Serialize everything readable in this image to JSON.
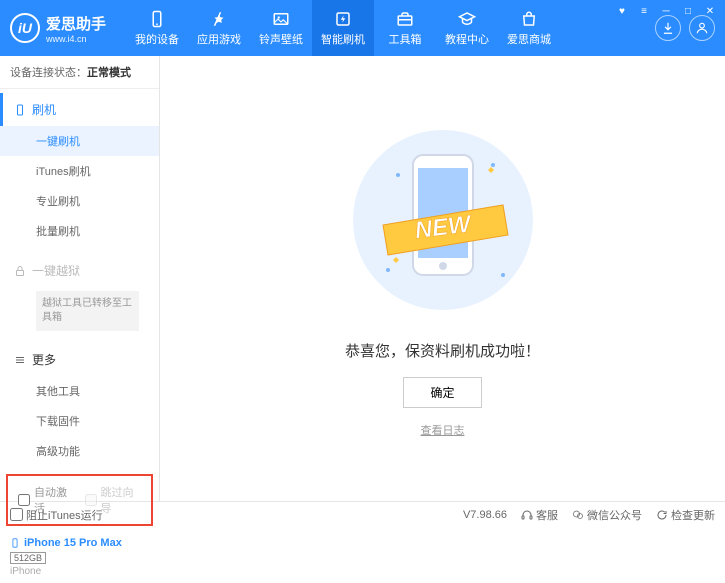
{
  "app": {
    "title": "爱思助手",
    "subtitle": "www.i4.cn",
    "logoLetter": "iU"
  },
  "nav": {
    "items": [
      {
        "label": "我的设备"
      },
      {
        "label": "应用游戏"
      },
      {
        "label": "铃声壁纸"
      },
      {
        "label": "智能刷机"
      },
      {
        "label": "工具箱"
      },
      {
        "label": "教程中心"
      },
      {
        "label": "爱思商城"
      }
    ],
    "activeIndex": 3
  },
  "status": {
    "prefix": "设备连接状态：",
    "mode": "正常模式"
  },
  "sidebar": {
    "flash": {
      "header": "刷机",
      "items": [
        "一键刷机",
        "iTunes刷机",
        "专业刷机",
        "批量刷机"
      ],
      "activeIndex": 0
    },
    "jailbreak": {
      "header": "一键越狱",
      "notice": "越狱工具已转移至工具箱"
    },
    "more": {
      "header": "更多",
      "items": [
        "其他工具",
        "下载固件",
        "高级功能"
      ]
    }
  },
  "checkboxes": {
    "autoActivate": "自动激活",
    "skipGuide": "跳过向导"
  },
  "device": {
    "name": "iPhone 15 Pro Max",
    "storage": "512GB",
    "type": "iPhone"
  },
  "main": {
    "newBadge": "NEW",
    "successText": "恭喜您，保资料刷机成功啦！",
    "okButton": "确定",
    "viewLog": "查看日志"
  },
  "footer": {
    "blockItunes": "阻止iTunes运行",
    "version": "V7.98.66",
    "support": "客服",
    "wechat": "微信公众号",
    "checkUpdate": "检查更新"
  }
}
